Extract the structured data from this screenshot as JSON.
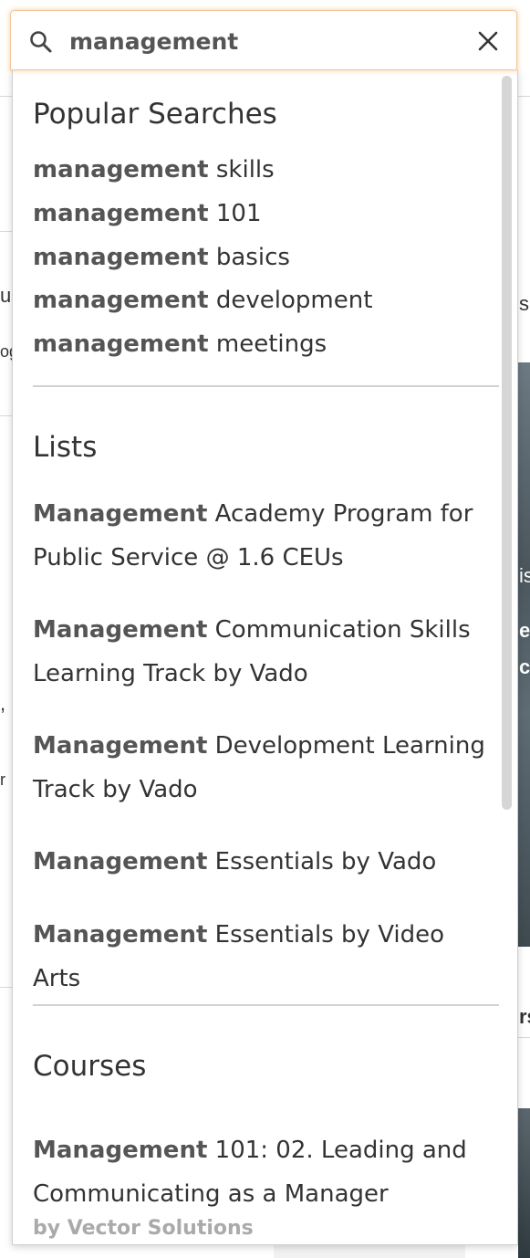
{
  "search": {
    "query": "management",
    "placeholder": ""
  },
  "popular": {
    "title": "Popular Searches",
    "items": [
      {
        "highlight": "management",
        "rest": " skills"
      },
      {
        "highlight": "management",
        "rest": " 101"
      },
      {
        "highlight": "management",
        "rest": " basics"
      },
      {
        "highlight": "management",
        "rest": " development"
      },
      {
        "highlight": "management",
        "rest": " meetings"
      }
    ]
  },
  "lists": {
    "title": "Lists",
    "items": [
      {
        "highlight": "Management",
        "rest": " Academy Program for Public Service @ 1.6 CEUs"
      },
      {
        "highlight": "Management",
        "rest": " Communication Skills Learning Track by Vado"
      },
      {
        "highlight": "Management",
        "rest": " Development Learning Track by Vado"
      },
      {
        "highlight": "Management",
        "rest": " Essentials by Vado"
      },
      {
        "highlight": "Management",
        "rest": " Essentials by Video Arts"
      }
    ]
  },
  "courses": {
    "title": "Courses",
    "items": [
      {
        "highlight": "Management",
        "rest": " 101: 02. Leading and Communicating as a Manager",
        "provider": "by Vector Solutions"
      }
    ]
  },
  "background_fragments": [
    "us",
    "og",
    "s",
    "is",
    "e",
    "c",
    ",",
    "r",
    "rs"
  ],
  "colors": {
    "focus_border": "#f0c79a",
    "highlight_text": "#555555",
    "muted_text": "#aaaaaa",
    "divider": "#d2d2d2"
  }
}
